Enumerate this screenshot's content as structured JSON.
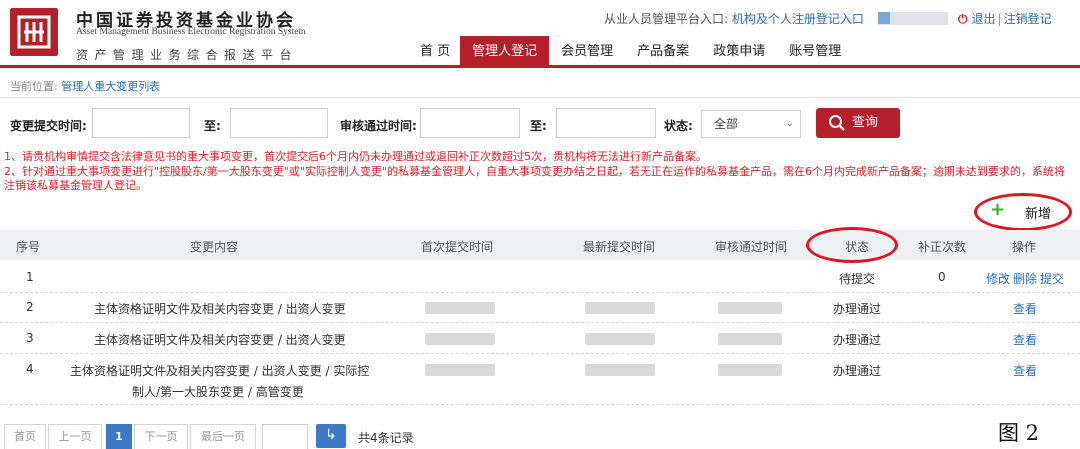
{
  "header": {
    "org_cn": "中国证券投资基金业协会",
    "org_en": "Asset Management Business Electronic Registration System",
    "org_sub": "资产管理业务综合报送平台",
    "entry_prefix": "从业人员管理平台入口:",
    "entry_link": "机构及个人注册登记入口",
    "logout": "退出",
    "logout_sep": "|",
    "cancel_registration": "注销登记"
  },
  "nav": [
    "首 页",
    "管理人登记",
    "会员管理",
    "产品备案",
    "政策申请",
    "账号管理"
  ],
  "nav_active_index": 1,
  "breadcrumb": {
    "prefix": "当前位置:",
    "current": "管理人重大变更列表"
  },
  "filter": {
    "submit_time_label": "变更提交时间:",
    "to_label_1": "至:",
    "approve_time_label": "审核通过时间:",
    "to_label_2": "至:",
    "status_label": "状态:",
    "status_value": "全部",
    "search_button": "查询"
  },
  "notices": [
    "1、请贵机构审慎提交含法律意见书的重大事项变更，首次提交后6个月内仍未办理通过或退回补正次数超过5次，贵机构将无法进行新产品备案。",
    "2、针对通过重大事项变更进行\"控股股东/第一大股东变更\"或\"实际控制人变更\"的私募基金管理人，自重大事项变更办结之日起，若无正在运作的私募基金产品，需在6个月内完成新产品备案；逾期未达到要求的，系统将注销该私募基金管理人登记。"
  ],
  "add_button": "新增",
  "table": {
    "headers": [
      "序号",
      "变更内容",
      "首次提交时间",
      "最新提交时间",
      "审核通过时间",
      "状态",
      "补正次数",
      "操作"
    ],
    "rows": [
      {
        "no": "1",
        "content": "",
        "status": "待提交",
        "corrections": "0",
        "actions": [
          "修改",
          "删除",
          "提交"
        ]
      },
      {
        "no": "2",
        "content": "主体资格证明文件及相关内容变更 / 出资人变更",
        "status": "办理通过",
        "corrections": "",
        "actions": [
          "查看"
        ]
      },
      {
        "no": "3",
        "content": "主体资格证明文件及相关内容变更 / 出资人变更",
        "status": "办理通过",
        "corrections": "",
        "actions": [
          "查看"
        ]
      },
      {
        "no": "4",
        "content_line1": "主体资格证明文件及相关内容变更 / 出资人变更 / 实际控",
        "content_line2": "制人/第一大股东变更 / 高管变更",
        "status": "办理通过",
        "corrections": "",
        "actions": [
          "查看"
        ]
      }
    ]
  },
  "pagination": {
    "first": "首页",
    "prev": "上一页",
    "current": "1",
    "next": "下一页",
    "last": "最后一页",
    "go_icon": "arrow-return-icon",
    "total": "共4条记录"
  },
  "figure_label": "图 2",
  "colors": {
    "brand_red": "#b3202a",
    "notice_red": "#e4202a",
    "link_blue": "#2a6fb5",
    "annotation_ring": "#e0151f",
    "add_green": "#2db52d"
  }
}
